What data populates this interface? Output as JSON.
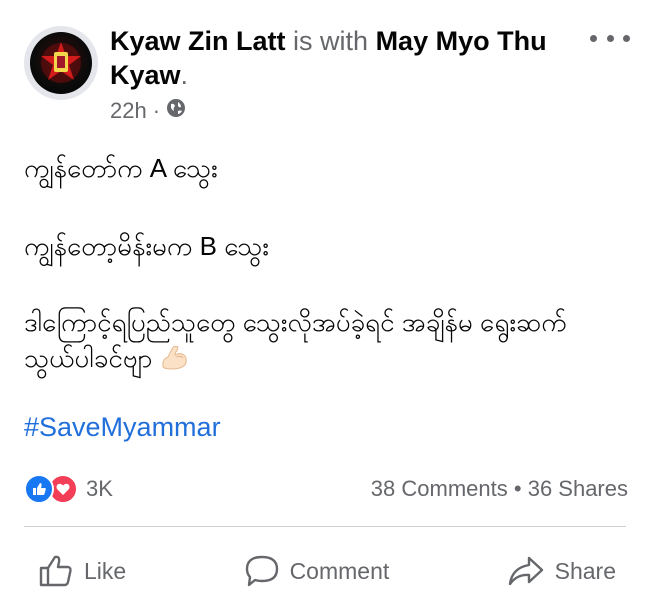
{
  "post": {
    "author": "Kyaw Zin Latt",
    "with_text": "is with",
    "tagged": "May Myo Thu Kyaw",
    "period": ".",
    "time": "22h",
    "dot": "·",
    "privacy_icon": "globe-icon",
    "more_icon": "more-options-icon",
    "lines": [
      "ကျွန်တော်က A သွေး",
      "ကျွန်တော့မိန်းမက B သွေး",
      "ဒါကြောင့်ရပြည်သူတွေ သွေးလိုအပ်ခဲ့ရင် အချိန်မ ရွေးဆက်သွယ်ပါခင်ဗျာ"
    ],
    "emoji": "flexed-biceps",
    "hashtag": "#SaveMyammar"
  },
  "stats": {
    "reaction_icons": [
      "like-reaction-icon",
      "love-reaction-icon"
    ],
    "reaction_count": "3K",
    "comments": "38 Comments",
    "separator": "•",
    "shares": "36 Shares"
  },
  "actions": {
    "like_label": "Like",
    "comment_label": "Comment",
    "share_label": "Share"
  },
  "colors": {
    "link": "#216fdb",
    "muted": "#65676b",
    "like_blue": "#1877f2",
    "love_red": "#f33e58"
  }
}
